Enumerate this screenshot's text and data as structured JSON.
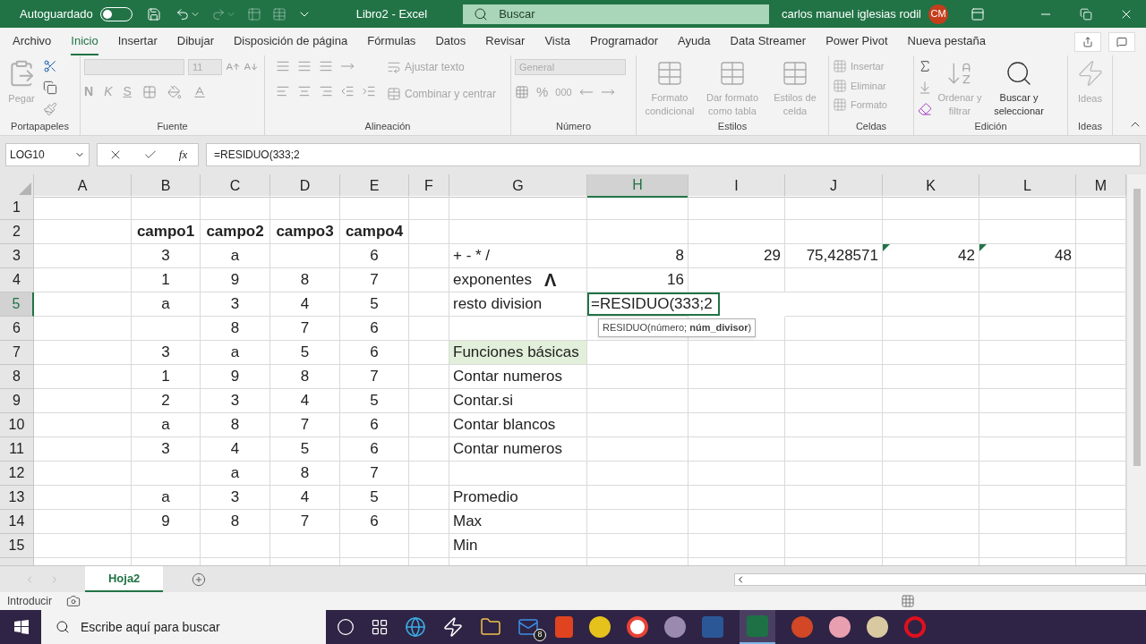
{
  "title_bar": {
    "autosave_label": "Autoguardado",
    "autosave_on": false,
    "title": "Libro2  -  Excel",
    "search": "Buscar",
    "user": "carlos manuel iglesias rodil",
    "initials": "CM"
  },
  "tabs": [
    {
      "label": "Archivo",
      "selected": false
    },
    {
      "label": "Inicio",
      "selected": true
    },
    {
      "label": "Insertar",
      "selected": false
    },
    {
      "label": "Dibujar",
      "selected": false
    },
    {
      "label": "Disposición de página",
      "selected": false
    },
    {
      "label": "Fórmulas",
      "selected": false
    },
    {
      "label": "Datos",
      "selected": false
    },
    {
      "label": "Revisar",
      "selected": false
    },
    {
      "label": "Vista",
      "selected": false
    },
    {
      "label": "Programador",
      "selected": false
    },
    {
      "label": "Ayuda",
      "selected": false
    },
    {
      "label": "Data Streamer",
      "selected": false
    },
    {
      "label": "Power Pivot",
      "selected": false
    },
    {
      "label": "Nueva pestaña",
      "selected": false
    }
  ],
  "ribbon": {
    "clipboard": {
      "label": "Portapapeles",
      "paste": {
        "label": "Pegar",
        "disabled": true
      }
    },
    "font": {
      "label": "Fuente",
      "size": "11",
      "bold": "N",
      "italic": "K",
      "underline": "S"
    },
    "alignment": {
      "label": "Alineación",
      "wrap": {
        "label": "Ajustar texto",
        "disabled": true
      },
      "merge": {
        "label": "Combinar y centrar",
        "disabled": true
      }
    },
    "number": {
      "label": "Número",
      "format": "General",
      "percent": "%",
      "thousands": "000"
    },
    "styles": {
      "label": "Estilos",
      "items": [
        {
          "label": "Formato condicional",
          "disabled": true
        },
        {
          "label": "Dar formato como tabla",
          "disabled": true
        },
        {
          "label": "Estilos de celda",
          "disabled": true
        }
      ]
    },
    "cells": {
      "label": "Celdas",
      "items": [
        {
          "label": "Insertar",
          "disabled": true
        },
        {
          "label": "Eliminar",
          "disabled": true
        },
        {
          "label": "Formato",
          "disabled": true
        }
      ]
    },
    "editing": {
      "label": "Edición",
      "sort": {
        "label": "Ordenar y filtrar",
        "disabled": true
      },
      "find": {
        "label": "Buscar y seleccionar",
        "disabled": false
      }
    },
    "ideas": {
      "label": "Ideas",
      "button": {
        "label": "Ideas",
        "disabled": true
      }
    }
  },
  "formula_bar": {
    "name_box": "LOG10",
    "function_button": "fx",
    "formula": "=RESIDUO(333;2"
  },
  "columns": [
    {
      "label": "A",
      "selected": false
    },
    {
      "label": "B",
      "selected": false
    },
    {
      "label": "C",
      "selected": false
    },
    {
      "label": "D",
      "selected": false
    },
    {
      "label": "E",
      "selected": false
    },
    {
      "label": "F",
      "selected": false
    },
    {
      "label": "G",
      "selected": false
    },
    {
      "label": "H",
      "selected": true
    },
    {
      "label": "I",
      "selected": false
    },
    {
      "label": "J",
      "selected": false
    },
    {
      "label": "K",
      "selected": false
    },
    {
      "label": "L",
      "selected": false
    },
    {
      "label": "M",
      "selected": false
    }
  ],
  "rows": [
    {
      "label": "1",
      "selected": false,
      "cells": {}
    },
    {
      "label": "2",
      "selected": false,
      "cells": {
        "B": {
          "text": "campo1",
          "bold": true
        },
        "C": {
          "text": "campo2",
          "bold": true
        },
        "D": {
          "text": "campo3",
          "bold": true
        },
        "E": {
          "text": "campo4",
          "bold": true
        }
      }
    },
    {
      "label": "3",
      "selected": false,
      "cells": {
        "B": {
          "text": "3"
        },
        "C": {
          "text": "a"
        },
        "E": {
          "text": "6"
        },
        "G": {
          "text": "+ - * /"
        },
        "H": {
          "text": "8"
        },
        "I": {
          "text": "29"
        },
        "J": {
          "text": "75,428571"
        },
        "K": {
          "text": "42",
          "error_mark": true
        },
        "L": {
          "text": "48",
          "error_mark": true
        }
      }
    },
    {
      "label": "4",
      "selected": false,
      "cells": {
        "B": {
          "text": "1"
        },
        "C": {
          "text": "9"
        },
        "D": {
          "text": "8"
        },
        "E": {
          "text": "7"
        },
        "G": {
          "text": "exponentes",
          "symbol": "Λ"
        },
        "H": {
          "text": "16"
        }
      }
    },
    {
      "label": "5",
      "selected": true,
      "cells": {
        "B": {
          "text": "a"
        },
        "C": {
          "text": "3"
        },
        "D": {
          "text": "4"
        },
        "E": {
          "text": "5"
        },
        "G": {
          "text": "resto division"
        },
        "H": {
          "text": "=RESIDUO(333;2",
          "editing": true,
          "hint": "RESIDUO(número; **núm_divisor**)"
        }
      }
    },
    {
      "label": "6",
      "selected": false,
      "cells": {
        "C": {
          "text": "8"
        },
        "D": {
          "text": "7"
        },
        "E": {
          "text": "6"
        }
      }
    },
    {
      "label": "7",
      "selected": false,
      "cells": {
        "B": {
          "text": "3"
        },
        "C": {
          "text": "a"
        },
        "D": {
          "text": "5"
        },
        "E": {
          "text": "6"
        },
        "G": {
          "text": "Funciones básicas",
          "highlight": true
        }
      }
    },
    {
      "label": "8",
      "selected": false,
      "cells": {
        "B": {
          "text": "1"
        },
        "C": {
          "text": "9"
        },
        "D": {
          "text": "8"
        },
        "E": {
          "text": "7"
        },
        "G": {
          "text": "Contar numeros"
        }
      }
    },
    {
      "label": "9",
      "selected": false,
      "cells": {
        "B": {
          "text": "2"
        },
        "C": {
          "text": "3"
        },
        "D": {
          "text": "4"
        },
        "E": {
          "text": "5"
        },
        "G": {
          "text": "Contar.si"
        }
      }
    },
    {
      "label": "10",
      "selected": false,
      "cells": {
        "B": {
          "text": "a"
        },
        "C": {
          "text": "8"
        },
        "D": {
          "text": "7"
        },
        "E": {
          "text": "6"
        },
        "G": {
          "text": "Contar blancos"
        }
      }
    },
    {
      "label": "11",
      "selected": false,
      "cells": {
        "B": {
          "text": "3"
        },
        "C": {
          "text": "4"
        },
        "D": {
          "text": "5"
        },
        "E": {
          "text": "6"
        },
        "G": {
          "text": "Contar numeros"
        }
      }
    },
    {
      "label": "12",
      "selected": false,
      "cells": {
        "C": {
          "text": "a"
        },
        "D": {
          "text": "8"
        },
        "E": {
          "text": "7"
        }
      }
    },
    {
      "label": "13",
      "selected": false,
      "cells": {
        "B": {
          "text": "a"
        },
        "C": {
          "text": "3"
        },
        "D": {
          "text": "4"
        },
        "E": {
          "text": "5"
        },
        "G": {
          "text": "Promedio"
        }
      }
    },
    {
      "label": "14",
      "selected": false,
      "cells": {
        "B": {
          "text": "9"
        },
        "C": {
          "text": "8"
        },
        "D": {
          "text": "7"
        },
        "E": {
          "text": "6"
        },
        "G": {
          "text": "Max"
        }
      }
    },
    {
      "label": "15",
      "selected": false,
      "cells": {
        "G": {
          "text": "Min"
        }
      }
    }
  ],
  "sheets": [
    {
      "label": "Hoja2",
      "selected": true
    }
  ],
  "status_bar": {
    "mode": "Introducir"
  },
  "taskbar": {
    "search": "Escribe aquí para buscar",
    "mail_badge": "8"
  }
}
